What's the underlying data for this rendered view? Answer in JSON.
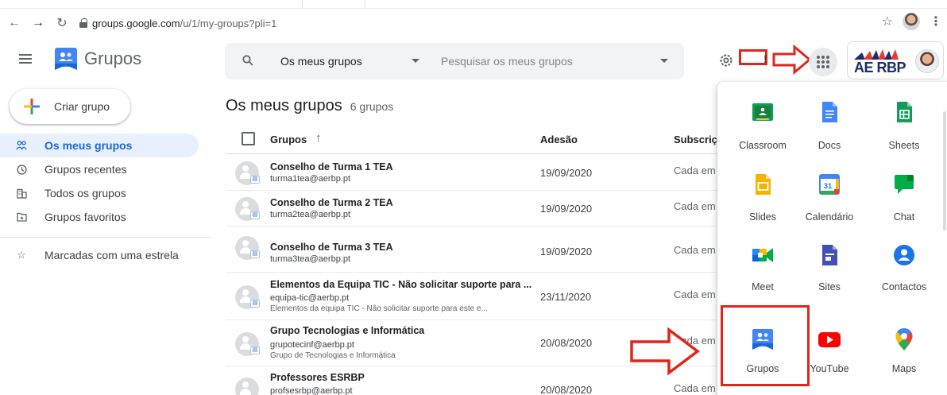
{
  "browser": {
    "url_domain": "groups.google.com",
    "url_path": "/u/1/my-groups?pli=1"
  },
  "header": {
    "app_title": "Grupos",
    "search_scope": "Os meus grupos",
    "search_placeholder": "Pesquisar os meus grupos",
    "account_logo_text": "AE RBP"
  },
  "sidebar": {
    "create_label": "Criar grupo",
    "items": [
      {
        "label": "Os meus grupos",
        "icon": "people-icon",
        "active": true
      },
      {
        "label": "Grupos recentes",
        "icon": "clock-icon",
        "active": false
      },
      {
        "label": "Todos os grupos",
        "icon": "building-icon",
        "active": false
      },
      {
        "label": "Grupos favoritos",
        "icon": "folder-star-icon",
        "active": false
      },
      {
        "label": "Marcadas com uma estrela",
        "icon": "star-icon",
        "active": false
      }
    ]
  },
  "main": {
    "title": "Os meus grupos",
    "count": "6 grupos",
    "columns": {
      "groups": "Grupos",
      "joined": "Adesão",
      "subscription": "Subscriç"
    },
    "rows": [
      {
        "name": "Conselho de Turma 1 TEA",
        "email": "turma1tea@aerbp.pt",
        "desc": "",
        "joined": "19/09/2020",
        "sub": "Cada em"
      },
      {
        "name": "Conselho de Turma 2 TEA",
        "email": "turma2tea@aerbp.pt",
        "desc": "",
        "joined": "19/09/2020",
        "sub": "Cada em"
      },
      {
        "name": "Conselho de Turma 3 TEA",
        "email": "turma3tea@aerbp.pt",
        "desc": "",
        "joined": "19/09/2020",
        "sub": "Cada em"
      },
      {
        "name": "Elementos da Equipa TIC - Não solicitar suporte para ...",
        "email": "equipa-tic@aerbp.pt",
        "desc": "Elementos da equipa TIC - Não solicitar suporte para este e...",
        "joined": "23/11/2020",
        "sub": "Cada em"
      },
      {
        "name": "Grupo Tecnologias e Informática",
        "email": "grupotecinf@aerbp.pt",
        "desc": "Grupo de Tecnologias e Informática",
        "joined": "20/08/2020",
        "sub": "Cada em"
      },
      {
        "name": "Professores ESRBP",
        "email": "profsesrbp@aerbp.pt",
        "desc": "",
        "joined": "20/08/2020",
        "sub": "Cada em"
      }
    ]
  },
  "apps_panel": {
    "apps": [
      {
        "label": "Classroom",
        "icon": "classroom-icon"
      },
      {
        "label": "Docs",
        "icon": "docs-icon"
      },
      {
        "label": "Sheets",
        "icon": "sheets-icon"
      },
      {
        "label": "Slides",
        "icon": "slides-icon"
      },
      {
        "label": "Calendário",
        "icon": "calendar-icon",
        "day": "31"
      },
      {
        "label": "Chat",
        "icon": "chat-icon"
      },
      {
        "label": "Meet",
        "icon": "meet-icon"
      },
      {
        "label": "Sites",
        "icon": "sites-icon"
      },
      {
        "label": "Contactos",
        "icon": "contacts-icon"
      },
      {
        "label": "Grupos",
        "icon": "groups-icon"
      },
      {
        "label": "YouTube",
        "icon": "youtube-icon"
      },
      {
        "label": "Maps",
        "icon": "maps-icon"
      }
    ]
  },
  "colors": {
    "accent": "#1967d2",
    "annotation_red": "#e0251b"
  }
}
